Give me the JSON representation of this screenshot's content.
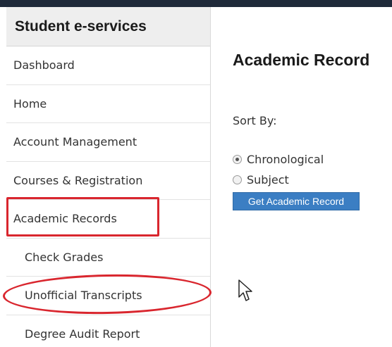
{
  "sidebar": {
    "title": "Student e-services",
    "items": [
      {
        "label": "Dashboard",
        "sub": false
      },
      {
        "label": "Home",
        "sub": false
      },
      {
        "label": "Account Management",
        "sub": false
      },
      {
        "label": "Courses & Registration",
        "sub": false
      },
      {
        "label": "Academic Records",
        "sub": false
      },
      {
        "label": "Check Grades",
        "sub": true
      },
      {
        "label": "Unofficial Transcripts",
        "sub": true
      },
      {
        "label": "Degree Audit Report",
        "sub": true
      }
    ]
  },
  "main": {
    "title": "Academic Record",
    "sort_label": "Sort By:",
    "options": [
      {
        "label": "Chronological",
        "checked": true
      },
      {
        "label": "Subject",
        "checked": false
      }
    ],
    "button_label": "Get Academic Record"
  },
  "colors": {
    "top_bar": "#1f2a3a",
    "button": "#3b7ec3",
    "annotation": "#d9262e"
  },
  "icons": {
    "cursor": "mouse-pointer-icon",
    "radio": "radio-button-icon"
  }
}
